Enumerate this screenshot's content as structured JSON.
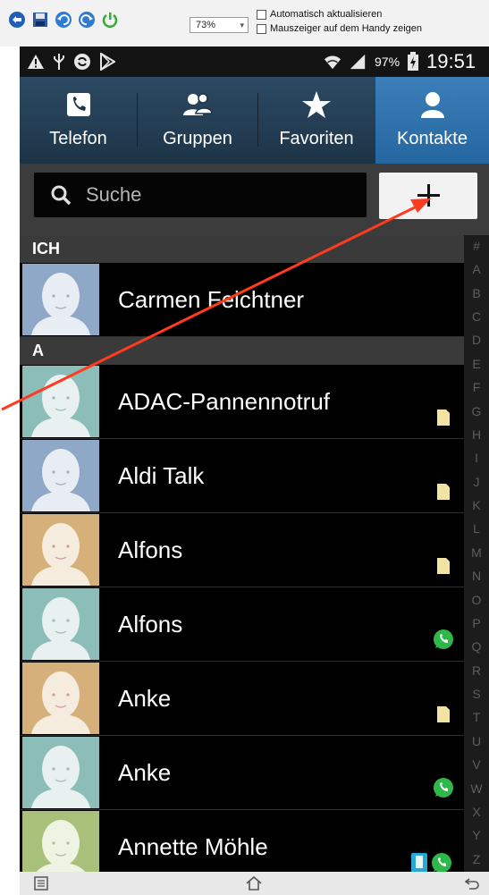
{
  "host_toolbar": {
    "zoom": "73%",
    "checkbox_auto_refresh": "Automatisch aktualisieren",
    "checkbox_show_pointer": "Mauszeiger auf dem Handy zeigen"
  },
  "status_bar": {
    "battery": "97%",
    "time": "19:51"
  },
  "tabs": [
    {
      "label": "Telefon",
      "icon": "phone-icon"
    },
    {
      "label": "Gruppen",
      "icon": "group-icon"
    },
    {
      "label": "Favoriten",
      "icon": "star-icon"
    },
    {
      "label": "Kontakte",
      "icon": "person-icon",
      "active": true
    }
  ],
  "search": {
    "placeholder": "Suche"
  },
  "sections": {
    "me": "ICH",
    "a": "A"
  },
  "contacts": [
    {
      "name": "Carmen Feichtner",
      "section": "ICH",
      "avatar_color": "#8fa8c8",
      "badge": "none"
    },
    {
      "name": "ADAC-Pannennotruf",
      "section": "A",
      "avatar_color": "#8cbdb8",
      "badge": "sim-card-icon"
    },
    {
      "name": "Aldi Talk",
      "section": "A",
      "avatar_color": "#8fa8c8",
      "badge": "sim-card-icon"
    },
    {
      "name": "Alfons",
      "section": "A",
      "avatar_color": "#d6b07a",
      "badge": "sim-card-icon"
    },
    {
      "name": "Alfons",
      "section": "A",
      "avatar_color": "#8cbdb8",
      "badge": "whatsapp-icon"
    },
    {
      "name": "Anke",
      "section": "A",
      "avatar_color": "#d6b07a",
      "badge": "sim-card-icon"
    },
    {
      "name": "Anke",
      "section": "A",
      "avatar_color": "#8cbdb8",
      "badge": "whatsapp-icon"
    },
    {
      "name": "Annette Möhle",
      "section": "A",
      "avatar_color": "#a9c07a",
      "badge": "phone-and-whatsapp-icon"
    }
  ],
  "alphabet": [
    "#",
    "A",
    "B",
    "C",
    "D",
    "E",
    "F",
    "G",
    "H",
    "I",
    "J",
    "K",
    "L",
    "M",
    "N",
    "O",
    "P",
    "Q",
    "R",
    "S",
    "T",
    "U",
    "V",
    "W",
    "X",
    "Y",
    "Z"
  ],
  "colors": {
    "tab_bar": "#2c4a64",
    "tab_active": "#2f73ac",
    "annotation_arrow": "#ff3b1f",
    "whatsapp": "#2fb84a"
  }
}
